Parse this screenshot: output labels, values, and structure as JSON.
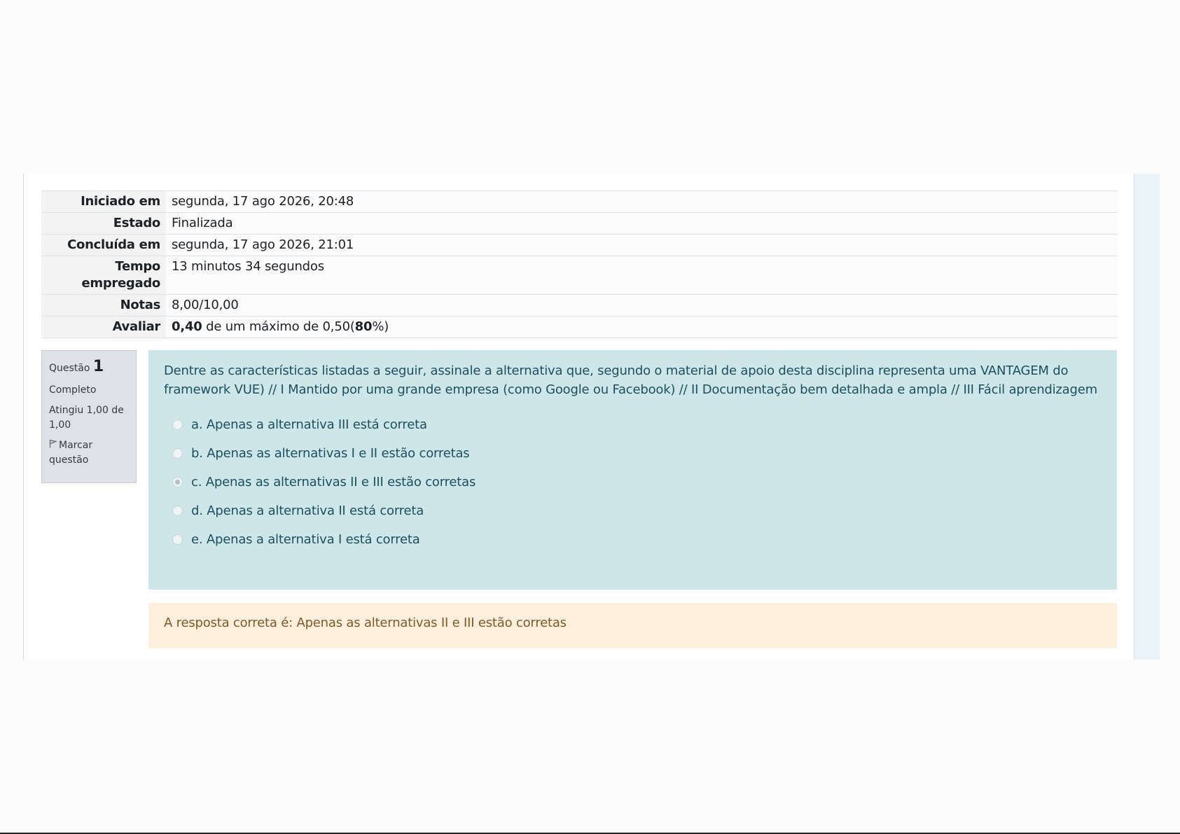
{
  "summary": {
    "rows": [
      {
        "label": "Iniciado em",
        "value": "segunda, 17 ago 2026, 20:48"
      },
      {
        "label": "Estado",
        "value": "Finalizada"
      },
      {
        "label": "Concluída em",
        "value": "segunda, 17 ago 2026, 21:01"
      },
      {
        "label": "Tempo empregado",
        "value": "13 minutos 34 segundos"
      },
      {
        "label": "Notas",
        "value": "8,00/10,00"
      }
    ],
    "grade": {
      "label": "Avaliar",
      "score": "0,40",
      "middle": " de um máximo de 0,50(",
      "percent": "80",
      "suffix": "%)"
    }
  },
  "question": {
    "info": {
      "question_word": "Questão",
      "number": "1",
      "state": "Completo",
      "grade": "Atingiu 1,00 de 1,00",
      "flag_label": "Marcar questão",
      "flag_icon": "flag-icon"
    },
    "text": "Dentre as características listadas a seguir, assinale a alternativa que, segundo o material de apoio desta disciplina representa uma VANTAGEM do framework VUE) // I Mantido por uma grande empresa (como Google ou Facebook) // II Documentação bem detalhada e ampla // III Fácil aprendizagem",
    "options": [
      {
        "label": "a. Apenas a alternativa III está correta",
        "checked": false
      },
      {
        "label": "b. Apenas as alternativas I e II estão corretas",
        "checked": false
      },
      {
        "label": "c. Apenas as alternativas II e III estão corretas",
        "checked": true
      },
      {
        "label": "d. Apenas a alternativa II está correta",
        "checked": false
      },
      {
        "label": "e. Apenas a alternativa I está correta",
        "checked": false
      }
    ],
    "feedback": "A resposta correta é: Apenas as alternativas II e III estão corretas"
  },
  "colors": {
    "question_bg": "#cde6ea",
    "feedback_bg": "#fcefdc",
    "info_bg": "#dee2e6"
  }
}
